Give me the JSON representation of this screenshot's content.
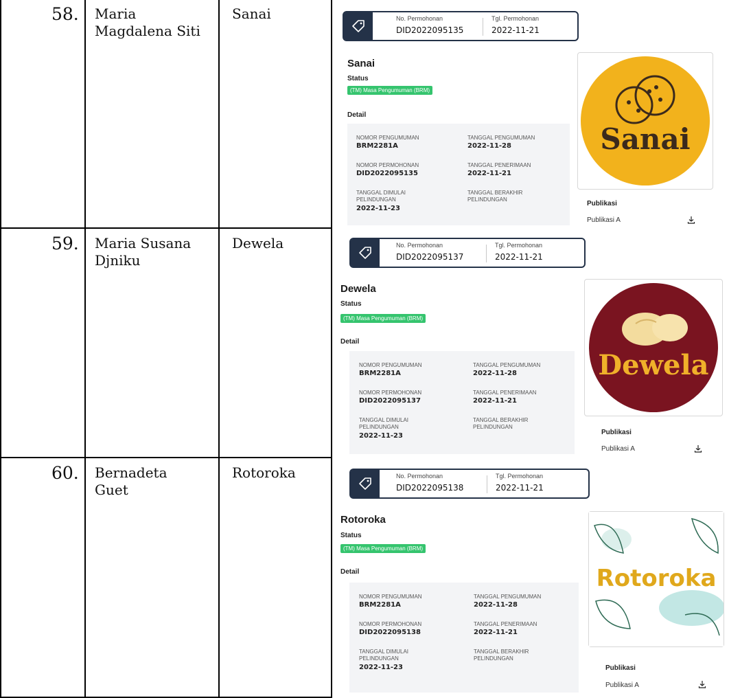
{
  "rows": [
    {
      "number": "58.",
      "name_lines": [
        "Maria",
        "Magdalena Siti"
      ],
      "brand": "Sanai",
      "app": {
        "no_label": "No. Permohonan",
        "no_value": "DID2022095135",
        "tgl_label": "Tgl. Permohonan",
        "tgl_value": "2022-11-21",
        "brand_title": "Sanai",
        "status_label": "Status",
        "status_badge": "(TM) Masa Pengumuman (BRM)",
        "detail_label": "Detail",
        "nomor_pengumuman_label": "NOMOR PENGUMUMAN",
        "nomor_pengumuman": "BRM2281A",
        "tanggal_pengumuman_label": "TANGGAL PENGUMUMAN",
        "tanggal_pengumuman": "2022-11-28",
        "nomor_permohonan_label": "NOMOR PERMOHONAN",
        "nomor_permohonan": "DID2022095135",
        "tanggal_penerimaan_label": "TANGGAL PENERIMAAN",
        "tanggal_penerimaan": "2022-11-21",
        "tanggal_dimulai_label_1": "TANGGAL DIMULAI",
        "tanggal_dimulai_label_2": "PELINDUNGAN",
        "tanggal_dimulai": "2022-11-23",
        "tanggal_berakhir_label_1": "TANGGAL BERAKHIR",
        "tanggal_berakhir_label_2": "PELINDUNGAN",
        "publikasi_label": "Publikasi",
        "publikasi_item": "Publikasi A",
        "logo_text": "Sanai",
        "logo_bg": "#f2b21c",
        "logo_fg": "#3b2a1c"
      }
    },
    {
      "number": "59.",
      "name_lines": [
        "Maria Susana",
        "Djniku"
      ],
      "brand": "Dewela",
      "app": {
        "no_label": "No. Permohonan",
        "no_value": "DID2022095137",
        "tgl_label": "Tgl. Permohonan",
        "tgl_value": "2022-11-21",
        "brand_title": "Dewela",
        "status_label": "Status",
        "status_badge": "(TM) Masa Pengumuman (BRM)",
        "detail_label": "Detail",
        "nomor_pengumuman_label": "NOMOR PENGUMUMAN",
        "nomor_pengumuman": "BRM2281A",
        "tanggal_pengumuman_label": "TANGGAL PENGUMUMAN",
        "tanggal_pengumuman": "2022-11-28",
        "nomor_permohonan_label": "NOMOR PERMOHONAN",
        "nomor_permohonan": "DID2022095137",
        "tanggal_penerimaan_label": "TANGGAL PENERIMAAN",
        "tanggal_penerimaan": "2022-11-21",
        "tanggal_dimulai_label_1": "TANGGAL DIMULAI",
        "tanggal_dimulai_label_2": "PELINDUNGAN",
        "tanggal_dimulai": "2022-11-23",
        "tanggal_berakhir_label_1": "TANGGAL BERAKHIR",
        "tanggal_berakhir_label_2": "PELINDUNGAN",
        "publikasi_label": "Publikasi",
        "publikasi_item": "Publikasi A",
        "logo_text": "Dewela",
        "logo_bg": "#7a1420",
        "logo_fg": "#f0b12a"
      }
    },
    {
      "number": "60.",
      "name_lines": [
        "Bernadeta",
        "Guet"
      ],
      "brand": "Rotoroka",
      "app": {
        "no_label": "No. Permohonan",
        "no_value": "DID2022095138",
        "tgl_label": "Tgl. Permohonan",
        "tgl_value": "2022-11-21",
        "brand_title": "Rotoroka",
        "status_label": "Status",
        "status_badge": "(TM) Masa Pengumuman (BRM)",
        "detail_label": "Detail",
        "nomor_pengumuman_label": "NOMOR PENGUMUMAN",
        "nomor_pengumuman": "BRM2281A",
        "tanggal_pengumuman_label": "TANGGAL PENGUMUMAN",
        "tanggal_pengumuman": "2022-11-28",
        "nomor_permohonan_label": "NOMOR PERMOHONAN",
        "nomor_permohonan": "DID2022095138",
        "tanggal_penerimaan_label": "TANGGAL PENERIMAAN",
        "tanggal_penerimaan": "2022-11-21",
        "tanggal_dimulai_label_1": "TANGGAL DIMULAI",
        "tanggal_dimulai_label_2": "PELINDUNGAN",
        "tanggal_dimulai": "2022-11-23",
        "tanggal_berakhir_label_1": "TANGGAL BERAKHIR",
        "tanggal_berakhir_label_2": "PELINDUNGAN",
        "publikasi_label": "Publikasi",
        "publikasi_item": "Publikasi A",
        "logo_text": "Rotoroka",
        "logo_bg": "#ffffff",
        "logo_fg": "#e0a81c"
      }
    }
  ]
}
